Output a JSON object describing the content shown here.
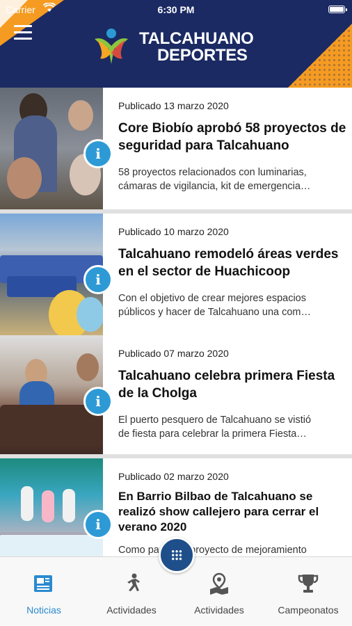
{
  "status_bar": {
    "carrier": "Carrier",
    "time": "6:30 PM"
  },
  "brand": {
    "line1": "TALCAHUANO",
    "line2": "DEPORTES"
  },
  "articles": [
    {
      "date": "Publicado 13 marzo 2020",
      "title": "Core Biobío aprobó 58 proyectos de seguridad para Talcahuano",
      "excerpt_line1": "58 proyectos relacionados con luminarias,",
      "excerpt_line2": "cámaras de vigilancia, kit de emergencia…"
    },
    {
      "date": "Publicado 10 marzo 2020",
      "title": "Talcahuano remodeló áreas verdes en el sector de Huachicoop",
      "excerpt_line1": "Con el objetivo de crear mejores espacios",
      "excerpt_line2": "públicos y hacer de Talcahuano una com…"
    },
    {
      "date": "Publicado 07 marzo 2020",
      "title": "Talcahuano celebra primera Fiesta de la Cholga",
      "excerpt_line1": "El puerto pesquero de Talcahuano se vistió",
      "excerpt_line2": "de fiesta para celebrar la primera Fiesta…"
    },
    {
      "date": "Publicado 02 marzo 2020",
      "title": "En Barrio Bilbao de Talcahuano se realizó show callejero para cerrar el verano 2020",
      "excerpt_line1": "Como parte del proyecto de mejoramiento",
      "excerpt_line2": ""
    }
  ],
  "tabs": [
    {
      "label": "Noticias",
      "icon": "newspaper-icon",
      "active": true
    },
    {
      "label": "Actividades",
      "icon": "runner-icon",
      "active": false
    },
    {
      "label": "Actividades",
      "icon": "map-pin-icon",
      "active": false
    },
    {
      "label": "Campeonatos",
      "icon": "trophy-icon",
      "active": false
    }
  ],
  "colors": {
    "header_bg": "#1b2a63",
    "accent_orange": "#f59b22",
    "info_button": "#2d9ad6",
    "tab_active": "#2a8ad0",
    "fab_bg": "#1f4f8a"
  }
}
